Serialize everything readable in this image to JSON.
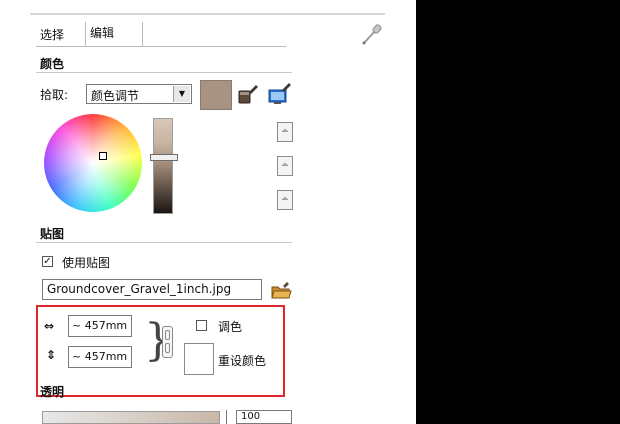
{
  "tabs": {
    "select": "选择",
    "edit": "编辑"
  },
  "color": {
    "title": "颜色",
    "pick_label": "拾取:",
    "pick_mode": "颜色调节",
    "swatch_color": "#a89282"
  },
  "texture": {
    "title": "贴图",
    "use_texture_label": "使用贴图",
    "use_texture_checked": true,
    "file_name": "Groundcover_Gravel_1inch.jpg",
    "width": "~ 457mm",
    "height": "~ 457mm",
    "tint_label": "调色",
    "tint_checked": false,
    "reset_color_label": "重设颜色"
  },
  "opacity": {
    "title": "透明",
    "value": "100"
  },
  "icons": {
    "paint": "paint-bucket-icon",
    "sample": "sample-paint-icon",
    "folder": "browse-folder-icon",
    "pen": "eyedropper-icon",
    "width": "width-arrow-icon",
    "height": "height-arrow-icon",
    "link": "aspect-lock-icon"
  },
  "colors": {
    "highlight": "#e0282c"
  }
}
